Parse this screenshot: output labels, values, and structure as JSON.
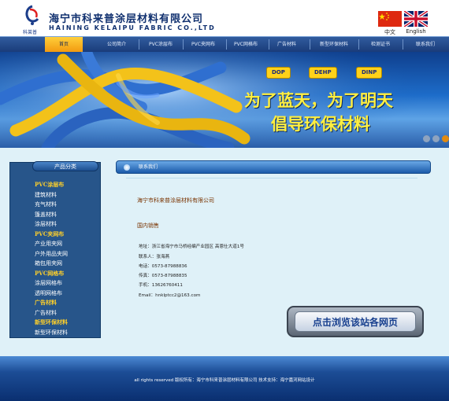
{
  "header": {
    "logo_text": "科莱普",
    "company_cn": "海宁市科来普涂层材料有限公司",
    "company_en": "HAINING KELAIPU FABRIC CO.,LTD",
    "lang_cn_label": "中文",
    "lang_en_label": "English",
    "icons": [
      "logo-icon",
      "china-flag-icon",
      "uk-flag-icon"
    ]
  },
  "nav": {
    "items": [
      {
        "label": "首页",
        "active": true
      },
      {
        "label": "公司简介"
      },
      {
        "label": "PVC涂层布"
      },
      {
        "label": "PVC夹网布"
      },
      {
        "label": "PVC网格布"
      },
      {
        "label": "广告材料"
      },
      {
        "label": "新型环保材料"
      },
      {
        "label": "检测证书"
      },
      {
        "label": "联系我们"
      }
    ]
  },
  "banner": {
    "chips": [
      "DOP",
      "DEHP",
      "DINP"
    ],
    "slogan_line1": "为了蓝天，为了明天",
    "slogan_line2": "倡导环保材料",
    "colors": {
      "chip": "#ffd21a",
      "slogan": "#ffef40",
      "rope_yellow": "#f3c21a",
      "rope_blue": "#2f6fd0"
    }
  },
  "sidebar": {
    "title": "产品分类",
    "items": [
      {
        "label": "PVC涂层布",
        "type": "category"
      },
      {
        "label": "建筑材料",
        "type": "sub"
      },
      {
        "label": "充气材料",
        "type": "sub"
      },
      {
        "label": "篷盖材料",
        "type": "sub"
      },
      {
        "label": "涂层材料",
        "type": "sub"
      },
      {
        "label": "PVC夹网布",
        "type": "category"
      },
      {
        "label": "产业用夹网",
        "type": "sub"
      },
      {
        "label": "户外用品夹网",
        "type": "sub"
      },
      {
        "label": "箱包用夹网",
        "type": "sub"
      },
      {
        "label": "PVC网格布",
        "type": "category"
      },
      {
        "label": "涂层网格布",
        "type": "sub"
      },
      {
        "label": "透明网格布",
        "type": "sub"
      },
      {
        "label": "广告材料",
        "type": "category"
      },
      {
        "label": "广告材料",
        "type": "sub"
      },
      {
        "label": "新型环保材料",
        "type": "category"
      },
      {
        "label": "新型环保材料",
        "type": "sub"
      }
    ]
  },
  "content": {
    "title": "联系我们",
    "company": "海宁市科来普涂层材料有限公司",
    "section": "国内销售",
    "lines": [
      "地址：浙江省海宁市马桥经编产业园区 高恩仕大道1号",
      "联系人：张海燕",
      "电话：0573-87988836",
      "传真：0573-87988835",
      "手机：13626760411",
      "Email：hnklptcc2@163.com"
    ],
    "browse_button": "点击浏览该站各网页"
  },
  "footer": {
    "text": "all rights reserved    版权所有：海宁市科来普涂层材料有限公司    技术支持：海宁嘉河网站设计"
  },
  "colors": {
    "nav_bg": "#1a3c7a",
    "nav_active": "#f29a10",
    "sidebar_bg": "#27558a",
    "category_text": "#ffd02a",
    "page_bg": "#dff1f8",
    "content_heading": "#7a3300"
  }
}
